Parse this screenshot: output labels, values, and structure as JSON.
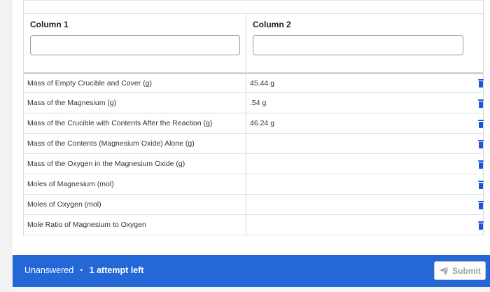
{
  "table": {
    "columns": [
      {
        "label": "Column 1",
        "input_value": ""
      },
      {
        "label": "Column 2",
        "input_value": ""
      }
    ],
    "rows": [
      {
        "c1": "Mass of Empty Crucible and Cover (g)",
        "c2": "45.44 g"
      },
      {
        "c1": "Mass of the Magnesium (g)",
        "c2": ".54 g"
      },
      {
        "c1": "Mass of the Crucible with Contents After the Reaction (g)",
        "c2": "46.24 g"
      },
      {
        "c1": "Mass of the Contents (Magnesium Oxide) Alone (g)",
        "c2": ""
      },
      {
        "c1": "Mass of the Oxygen in the Magnesium Oxide (g)",
        "c2": ""
      },
      {
        "c1": "Moles of Magnesium (mol)",
        "c2": ""
      },
      {
        "c1": "Moles of Oxygen (mol)",
        "c2": ""
      },
      {
        "c1": "Mole Ratio of Magnesium to Oxygen",
        "c2": ""
      }
    ],
    "row_action_icon": "trash-icon"
  },
  "footer": {
    "status": "Unanswered",
    "separator": "•",
    "attempts": "1 attempt left",
    "submit_label": "Submit",
    "submit_icon": "paper-plane-icon"
  },
  "colors": {
    "accent": "#2468d8",
    "icon": "#1a56db",
    "disabled_text": "#9aa0a6"
  }
}
